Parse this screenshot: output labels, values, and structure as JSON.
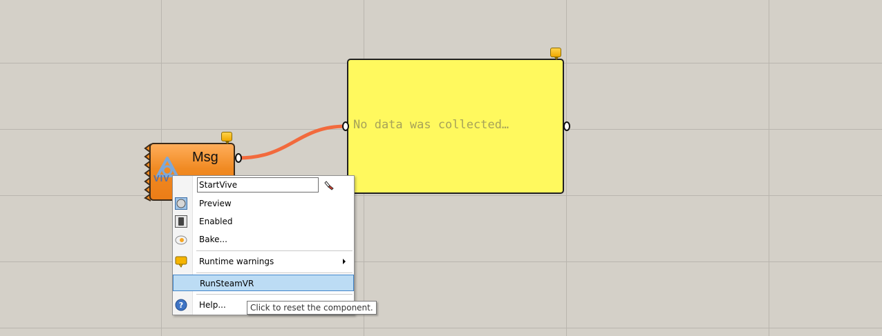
{
  "canvas": {
    "component": {
      "output_label": "Msg",
      "logo_text": "VIV"
    },
    "panel": {
      "text": "No data was collected…"
    }
  },
  "context_menu": {
    "name_value": "StartVive",
    "items": [
      {
        "label": "Preview",
        "icon": "preview-icon"
      },
      {
        "label": "Enabled",
        "icon": "enabled-icon"
      },
      {
        "label": "Bake...",
        "icon": "bake-icon"
      },
      {
        "label": "Runtime warnings",
        "icon": "warning-balloon-icon"
      },
      {
        "label": "RunSteamVR",
        "icon": ""
      },
      {
        "label": "Help...",
        "icon": "help-icon"
      }
    ]
  },
  "tooltip": {
    "text": "Click to reset the component."
  },
  "colors": {
    "canvas": "#d4d0c8",
    "component": "#f08a22",
    "panel": "#fff95e",
    "wire": "#f26a3d",
    "highlight": "#bcdcf4"
  }
}
